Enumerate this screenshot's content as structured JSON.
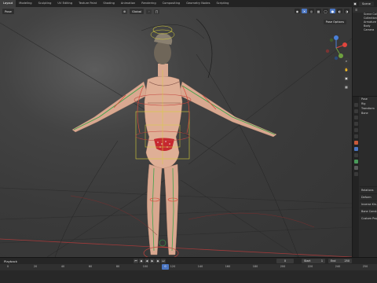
{
  "topbar": {
    "tabs": [
      "Layout",
      "Modeling",
      "Sculpting",
      "UV Editing",
      "Texture Paint",
      "Shading",
      "Animation",
      "Rendering",
      "Compositing",
      "Geometry Nodes",
      "Scripting"
    ],
    "active_tab": "Layout",
    "scene": "Scene"
  },
  "viewport": {
    "mode": "Pose",
    "transform_orientation": "Global",
    "pose_options": "Pose Options",
    "axis_colors": {
      "x": "#e0453d",
      "y": "#6ea03f",
      "z": "#4a80d8"
    },
    "accent": "#4b76c2"
  },
  "outliner": {
    "header": "Scene Collection",
    "rows": [
      "Scene Collection",
      "Collection",
      "Armature",
      "Body",
      "Camera"
    ]
  },
  "properties": {
    "rows": [
      "Pose",
      "Rig",
      "Transform",
      "Bone",
      "Relations",
      "Deform",
      "Inverse Kin.",
      "Bone Const.",
      "Custom Props"
    ]
  },
  "timeline": {
    "label": "Playback",
    "current_frame": "0",
    "start_label": "Start",
    "start": "1",
    "end_label": "End",
    "end": "250",
    "ticks": [
      "0",
      "20",
      "40",
      "60",
      "80",
      "100",
      "120",
      "140",
      "160",
      "180",
      "200",
      "220",
      "240",
      "250"
    ]
  }
}
